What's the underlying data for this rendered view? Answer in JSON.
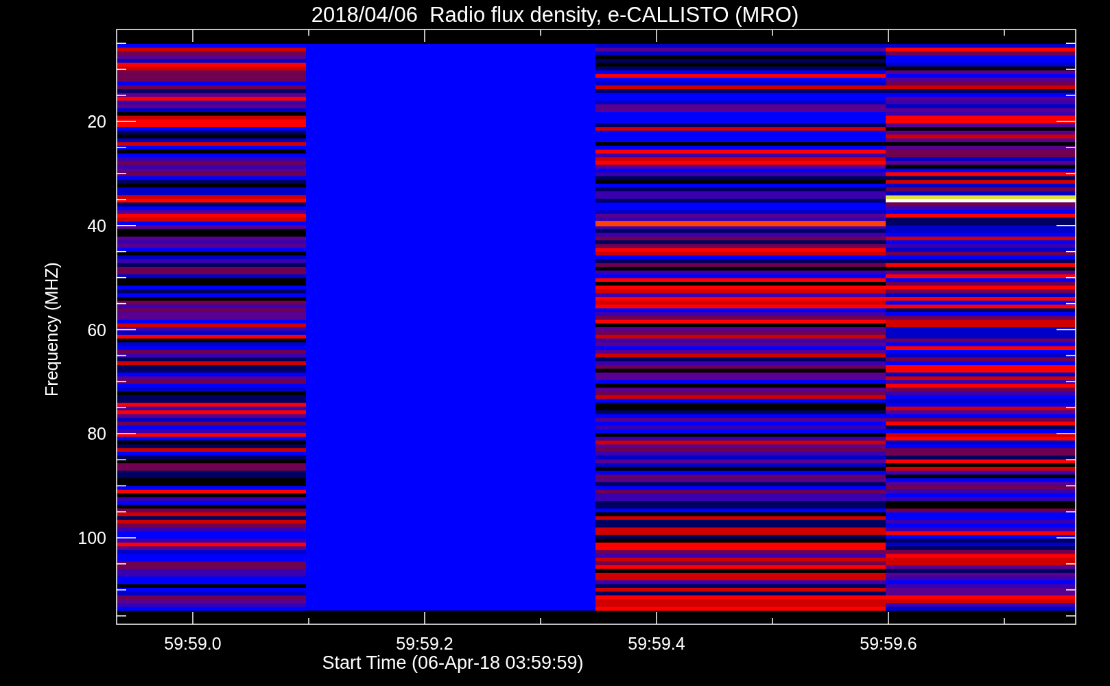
{
  "title": "2018/04/06  Radio flux density, e-CALLISTO (MRO)",
  "xlabel": "Start Time (06-Apr-18 03:59:59)",
  "ylabel": "Frequency (MHZ)",
  "xticks": [
    "59:59.0",
    "59:59.2",
    "59:59.4",
    "59:59.6"
  ],
  "yticks": [
    "20",
    "40",
    "60",
    "80",
    "100"
  ]
}
